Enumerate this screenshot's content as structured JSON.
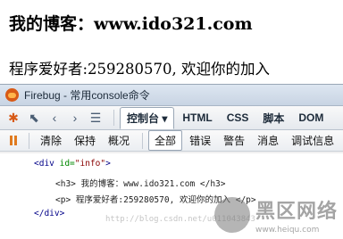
{
  "page": {
    "heading": "我的博客：www.ido321.com",
    "paragraph": "程序爱好者:259280570, 欢迎你的加入"
  },
  "firebug": {
    "title": "Firebug - 常用console命令",
    "tabs": [
      {
        "label": "控制台 ▾",
        "active": true
      },
      {
        "label": "HTML"
      },
      {
        "label": "CSS"
      },
      {
        "label": "脚本"
      },
      {
        "label": "DOM"
      }
    ],
    "subtoolbar": {
      "clear": "清除",
      "persist": "保持",
      "profile": "概况",
      "all": "全部",
      "errors": "错误",
      "warnings": "警告",
      "info": "消息",
      "debug": "调试信息"
    },
    "console_lines": {
      "l1_open": "<div ",
      "l1_attr": "id=",
      "l1_val": "\"info\"",
      "l1_close": ">",
      "l2": "<h3> 我的博客：www.ido321.com </h3>",
      "l3": "<p> 程序爱好者:259280570, 欢迎你的加入 </p>",
      "l4": "</div>"
    },
    "watermark": {
      "title": "黑区网络",
      "url": "www.heiqu.com",
      "ghost": "http://blog.csdn.net/u011043843"
    }
  },
  "colors": {
    "tag": "#000088",
    "attr": "#008800",
    "value": "#880000",
    "pause": "#e07a1f"
  }
}
